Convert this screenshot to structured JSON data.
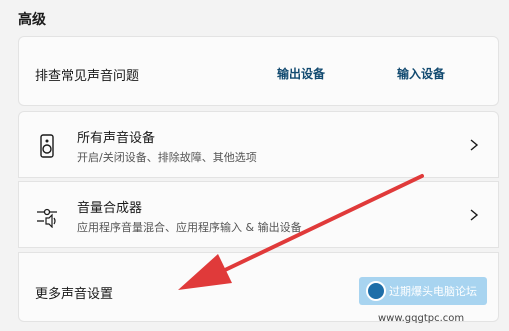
{
  "section": {
    "title": "高级"
  },
  "troubleshoot": {
    "label": "排查常见声音问题",
    "output_link": "输出设备",
    "input_link": "输入设备"
  },
  "rows": [
    {
      "title": "所有声音设备",
      "subtitle": "开启/关闭设备、排除故障、其他选项",
      "icon": "speaker-icon"
    },
    {
      "title": "音量合成器",
      "subtitle": "应用程序音量混合、应用程序输入 & 输出设备",
      "icon": "volume-mixer-icon"
    }
  ],
  "more": {
    "title": "更多声音设置"
  },
  "annotation": {
    "color": "#e03a3a"
  },
  "watermark": {
    "text": "过期爆头电脑论坛",
    "url": "www.gqgtpc.com"
  }
}
